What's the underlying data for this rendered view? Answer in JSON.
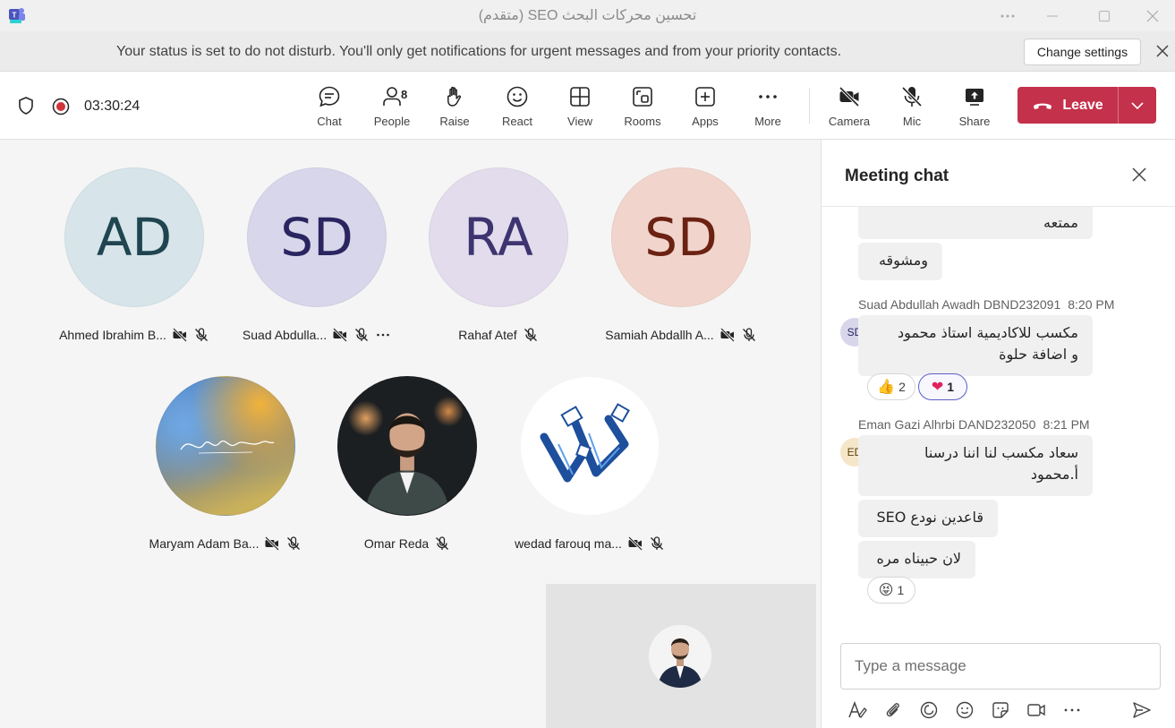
{
  "window": {
    "title": "تحسين محركات البحث SEO (متقدم)"
  },
  "banner": {
    "message": "Your status is set to do not disturb. You'll only get notifications for urgent messages and from your priority contacts.",
    "change_label": "Change settings"
  },
  "toolbar": {
    "timer": "03:30:24",
    "chat": "Chat",
    "people": "People",
    "people_count": "8",
    "raise": "Raise",
    "react": "React",
    "view": "View",
    "rooms": "Rooms",
    "apps": "Apps",
    "more": "More",
    "camera": "Camera",
    "mic": "Mic",
    "share": "Share",
    "leave": "Leave"
  },
  "participants": [
    {
      "initials": "AD",
      "name": "Ahmed Ibrahim B...",
      "bg": "#d7e4ea",
      "fg": "#1f4550"
    },
    {
      "initials": "SD",
      "name": "Suad Abdulla...",
      "bg": "#d8d6ea",
      "fg": "#2a2560"
    },
    {
      "initials": "RA",
      "name": "Rahaf Atef",
      "bg": "#e2dcec",
      "fg": "#3d3470"
    },
    {
      "initials": "SD",
      "name": "Samiah Abdallh A...",
      "bg": "#f1d5cc",
      "fg": "#6b2212"
    },
    {
      "initials": "",
      "name": "Maryam Adam Ba..."
    },
    {
      "initials": "",
      "name": "Omar Reda"
    },
    {
      "initials": "",
      "name": "wedad farouq ma..."
    }
  ],
  "chat": {
    "title": "Meeting chat",
    "messages": {
      "m1": "ممتعه",
      "m2": "ومشوقه",
      "suad_name": "Suad Abdullah Awadh DBND232091",
      "suad_time": "8:20 PM",
      "suad_initials": "SD",
      "m3_line1": "مكسب للاكاديمية استاذ محمود",
      "m3_line2": "و اضافة حلوة",
      "reaction_like": "2",
      "reaction_heart": "1",
      "eman_name": "Eman Gazi Alhrbi DAND232050",
      "eman_time": "8:21 PM",
      "eman_initials": "ED",
      "m4_line1": "سعاد مكسب لنا اننا درسنا",
      "m4_line2": "أ.محمود",
      "m5": "قاعدين نودع SEO",
      "m6": "لان حبيناه مره",
      "reaction_laugh": "1"
    },
    "compose_placeholder": "Type a message"
  },
  "colors": {
    "accent": "#5b5fc7",
    "leave": "#c4314b",
    "busy": "#d13438",
    "available": "#13a10e"
  }
}
